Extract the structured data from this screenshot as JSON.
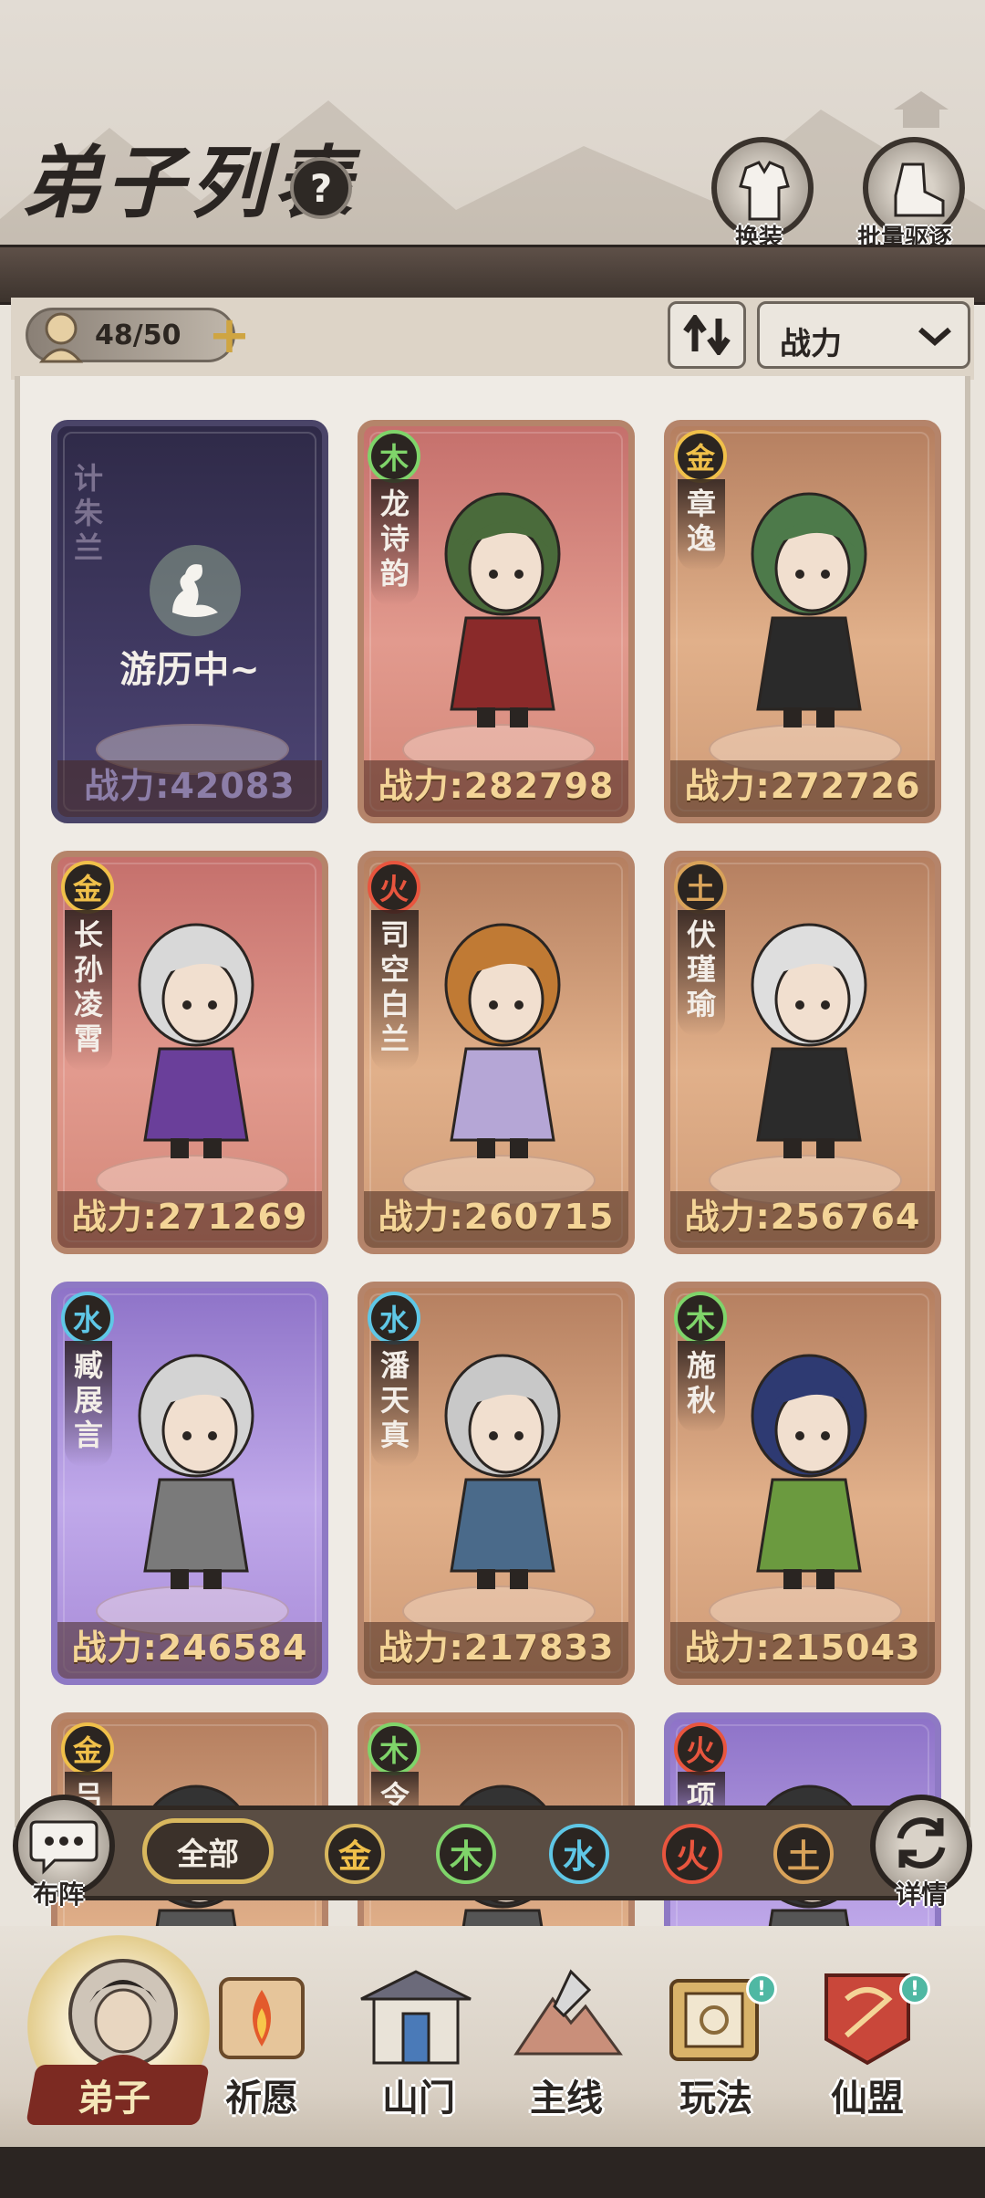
{
  "header": {
    "title": "弟子列表",
    "help": "?",
    "change_outfit": "换装",
    "batch_dismiss": "批量驱逐"
  },
  "toolbar": {
    "count": "48/50",
    "add": "+",
    "sort_icon": "sort-arrows-icon",
    "sort_by": "战力"
  },
  "cards": [
    {
      "name": "计朱兰",
      "element": "",
      "power": "战力:42083",
      "status": "游历中~",
      "style": "purple-dark"
    },
    {
      "name": "龙诗韵",
      "element": "木",
      "power": "战力:282798",
      "style": "red",
      "hair": "#4a6b3b",
      "robe": "#8a2a2a"
    },
    {
      "name": "章逸",
      "element": "金",
      "power": "战力:272726",
      "style": "tan",
      "hair": "#4d7a4a",
      "robe": "#2a2a2a"
    },
    {
      "name": "长孙凌霄",
      "element": "金",
      "power": "战力:271269",
      "style": "red",
      "hair": "#d8d8d8",
      "robe": "#6a3f9a"
    },
    {
      "name": "司空白兰",
      "element": "火",
      "power": "战力:260715",
      "style": "tan",
      "hair": "#c07a34",
      "robe": "#b5a6d6"
    },
    {
      "name": "伏瑾瑜",
      "element": "土",
      "power": "战力:256764",
      "style": "tan",
      "hair": "#dedede",
      "robe": "#2b2b2b"
    },
    {
      "name": "臧展言",
      "element": "水",
      "power": "战力:246584",
      "style": "violet",
      "hair": "#d3d3d3",
      "robe": "#7a7a7a"
    },
    {
      "name": "潘天真",
      "element": "水",
      "power": "战力:217833",
      "style": "tan",
      "hair": "#c8c8c8",
      "robe": "#4a6a8a"
    },
    {
      "name": "施秋",
      "element": "木",
      "power": "战力:215043",
      "style": "tan",
      "hair": "#2e3a72",
      "robe": "#6b9a3f"
    },
    {
      "name": "吕",
      "element": "金",
      "style": "tan"
    },
    {
      "name": "令",
      "element": "木",
      "style": "tan"
    },
    {
      "name": "项",
      "element": "火",
      "style": "violet"
    }
  ],
  "element_colors": {
    "金": "#f0c04a",
    "木": "#7fd46a",
    "水": "#5fc7e6",
    "火": "#e8553e",
    "土": "#d9a35a"
  },
  "filter": {
    "formation": "布阵",
    "all": "全部",
    "elements": [
      "金",
      "木",
      "水",
      "火",
      "土"
    ],
    "details": "详情"
  },
  "nav": {
    "items": [
      {
        "label": "弟子",
        "icon": "disciple-portrait-icon"
      },
      {
        "label": "祈愿",
        "icon": "wish-scroll-icon"
      },
      {
        "label": "山门",
        "icon": "sect-gate-icon"
      },
      {
        "label": "主线",
        "icon": "main-quest-icon"
      },
      {
        "label": "玩法",
        "icon": "gameplay-book-icon",
        "badge": "!"
      },
      {
        "label": "仙盟",
        "icon": "alliance-banner-icon",
        "badge": "!"
      }
    ]
  }
}
